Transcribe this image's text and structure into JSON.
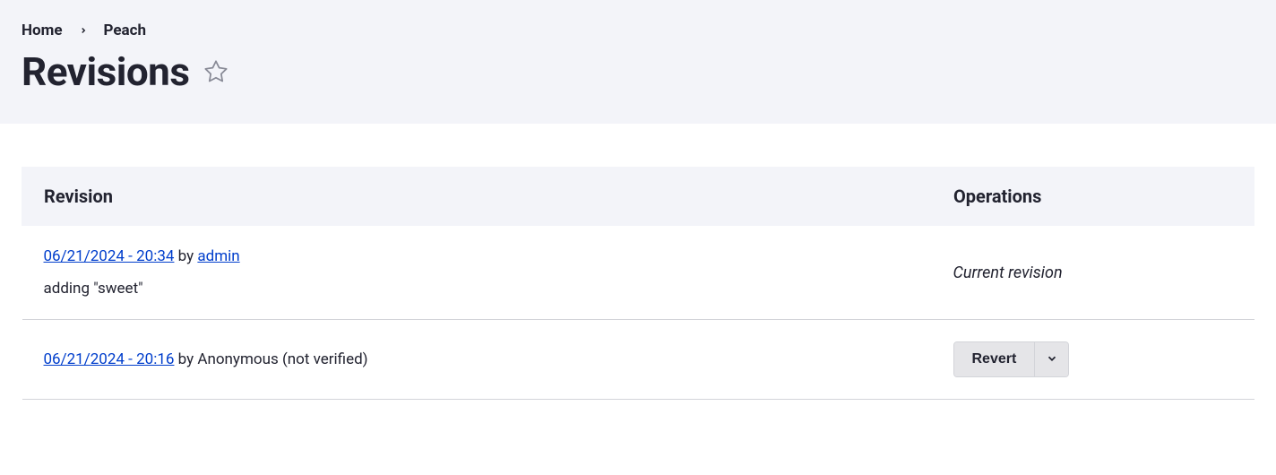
{
  "breadcrumb": {
    "home": "Home",
    "current": "Peach"
  },
  "page_title": "Revisions",
  "table": {
    "headers": {
      "revision": "Revision",
      "operations": "Operations"
    }
  },
  "revisions": [
    {
      "timestamp": "06/21/2024 - 20:34",
      "by": " by ",
      "author": "admin",
      "author_is_link": true,
      "message": "adding \"sweet\"",
      "operation": "Current revision",
      "is_current": true
    },
    {
      "timestamp": "06/21/2024 - 20:16",
      "by": " by ",
      "author": "Anonymous (not verified)",
      "author_is_link": false,
      "operation": "Revert",
      "is_current": false
    }
  ]
}
